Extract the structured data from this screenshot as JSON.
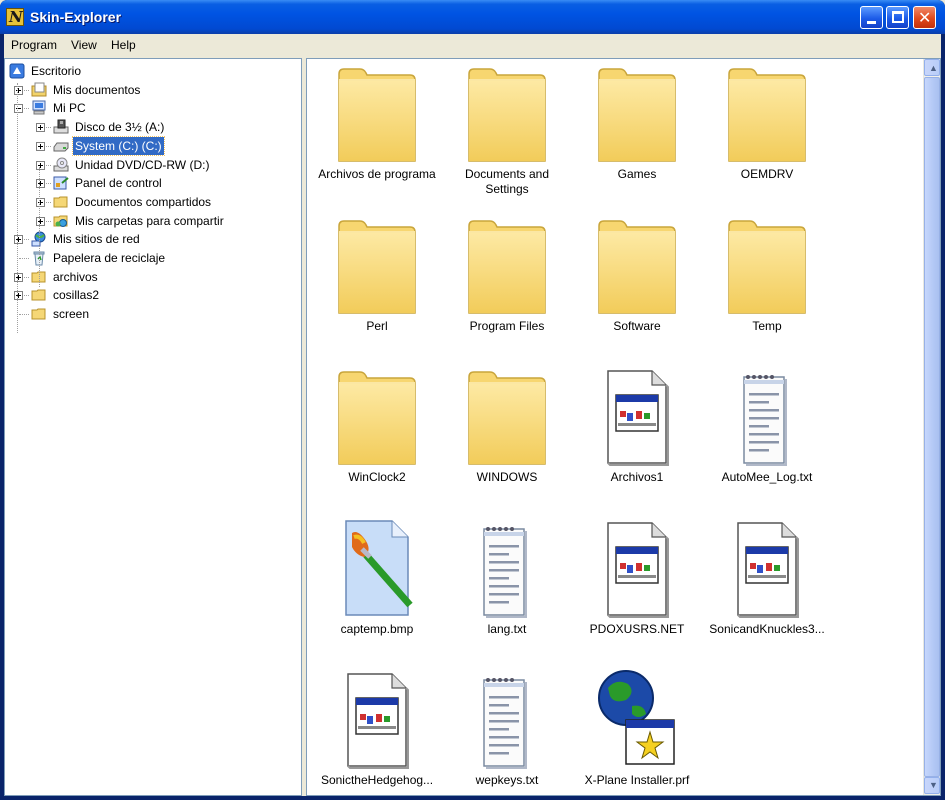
{
  "window": {
    "title": "Skin-Explorer",
    "app_icon": "app-logo-icon"
  },
  "menubar": {
    "items": [
      "Program",
      "View",
      "Help"
    ]
  },
  "tree": {
    "items": [
      {
        "label": "Escritorio",
        "icon": "desktop-icon"
      },
      {
        "label": "Mis documentos",
        "icon": "my-documents-icon"
      },
      {
        "label": "Mi PC",
        "icon": "my-computer-icon"
      },
      {
        "label": "Disco de 3½ (A:)",
        "icon": "floppy-drive-icon"
      },
      {
        "label": "System (C:) (C:)",
        "icon": "hard-drive-icon",
        "selected": true
      },
      {
        "label": "Unidad DVD/CD-RW (D:)",
        "icon": "dvd-drive-icon"
      },
      {
        "label": "Panel de control",
        "icon": "control-panel-icon"
      },
      {
        "label": "Documentos compartidos",
        "icon": "folder-icon"
      },
      {
        "label": "Mis carpetas para compartir",
        "icon": "shared-folder-icon"
      },
      {
        "label": "Mis sitios de red",
        "icon": "network-places-icon"
      },
      {
        "label": "Papelera de reciclaje",
        "icon": "recycle-bin-icon"
      },
      {
        "label": "archivos",
        "icon": "folder-icon"
      },
      {
        "label": "cosillas2",
        "icon": "folder-icon"
      },
      {
        "label": "screen",
        "icon": "folder-icon"
      }
    ]
  },
  "files": {
    "items": [
      {
        "name": "Archivos de programa",
        "type": "folder"
      },
      {
        "name": "Documents and Settings",
        "type": "folder"
      },
      {
        "name": "Games",
        "type": "folder"
      },
      {
        "name": "OEMDRV",
        "type": "folder"
      },
      {
        "name": "Perl",
        "type": "folder"
      },
      {
        "name": "Program Files",
        "type": "folder"
      },
      {
        "name": "Software",
        "type": "folder"
      },
      {
        "name": "Temp",
        "type": "folder"
      },
      {
        "name": "WinClock2",
        "type": "folder"
      },
      {
        "name": "WINDOWS",
        "type": "folder"
      },
      {
        "name": "Archivos1",
        "type": "app-file"
      },
      {
        "name": "AutoMee_Log.txt",
        "type": "text-file"
      },
      {
        "name": "captemp.bmp",
        "type": "bitmap-file"
      },
      {
        "name": "lang.txt",
        "type": "text-file"
      },
      {
        "name": "PDOXUSRS.NET",
        "type": "app-file"
      },
      {
        "name": "SonicandKnuckles3...",
        "type": "app-file"
      },
      {
        "name": "SonictheHedgehog...",
        "type": "app-file"
      },
      {
        "name": "wepkeys.txt",
        "type": "text-file"
      },
      {
        "name": "X-Plane Installer.prf",
        "type": "installer-file"
      }
    ]
  }
}
